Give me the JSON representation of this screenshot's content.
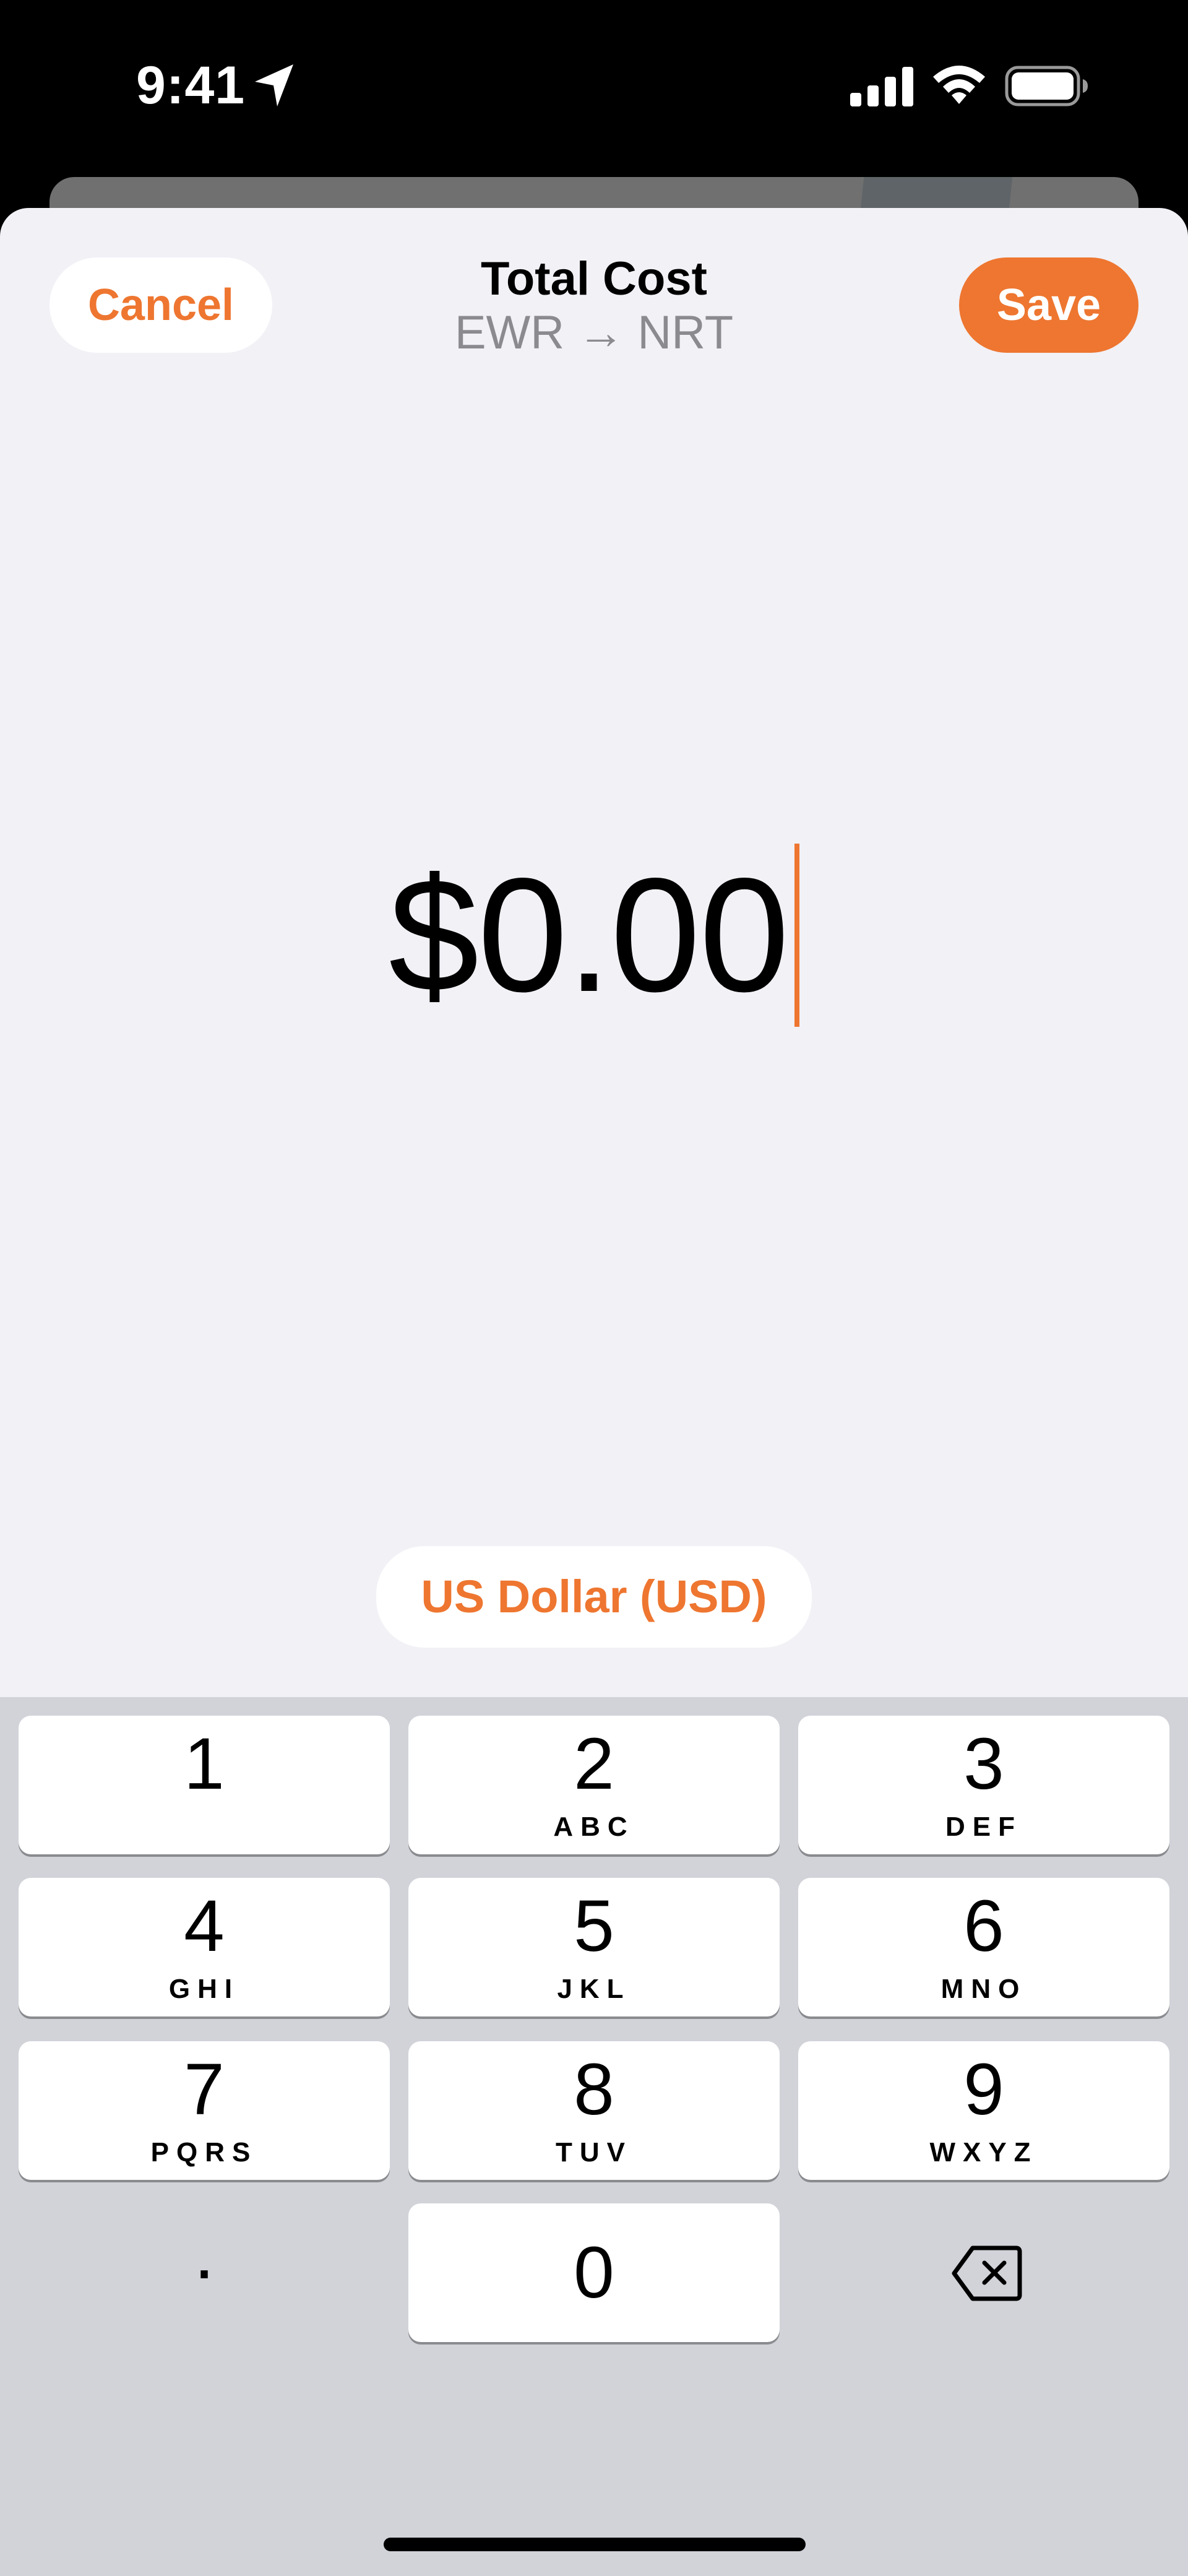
{
  "status_bar": {
    "time": "9:41",
    "icons": [
      "location-arrow-icon",
      "cellular-signal-icon",
      "wifi-icon",
      "battery-icon"
    ]
  },
  "header": {
    "cancel_label": "Cancel",
    "title": "Total Cost",
    "subtitle": "EWR → NRT",
    "save_label": "Save"
  },
  "amount": {
    "value": "$0.00"
  },
  "currency": {
    "label": "US Dollar (USD)"
  },
  "keypad": {
    "keys": [
      {
        "digit": "1",
        "letters": ""
      },
      {
        "digit": "2",
        "letters": "ABC"
      },
      {
        "digit": "3",
        "letters": "DEF"
      },
      {
        "digit": "4",
        "letters": "GHI"
      },
      {
        "digit": "5",
        "letters": "JKL"
      },
      {
        "digit": "6",
        "letters": "MNO"
      },
      {
        "digit": "7",
        "letters": "PQRS"
      },
      {
        "digit": "8",
        "letters": "TUV"
      },
      {
        "digit": "9",
        "letters": "WXYZ"
      },
      {
        "digit": "0",
        "letters": ""
      }
    ],
    "decimal": ".",
    "delete_icon": "delete-backspace-icon"
  },
  "colors": {
    "accent": "#ee7630",
    "sheet_background": "#f2f1f6",
    "keyboard_background": "#d1d3d9",
    "subtitle_gray": "#8a8a8f"
  }
}
